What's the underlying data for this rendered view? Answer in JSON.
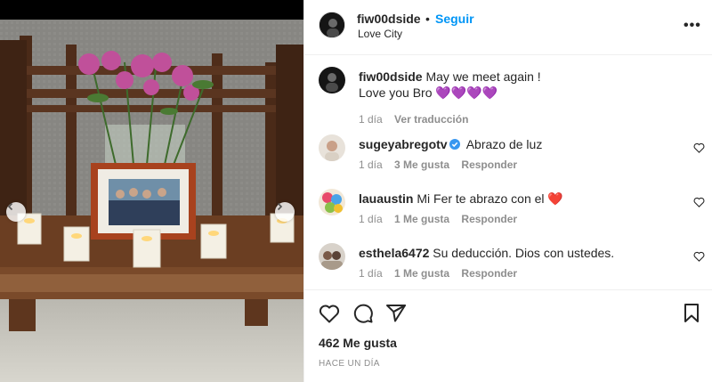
{
  "header": {
    "username": "fiw00dside",
    "separator": "•",
    "follow_label": "Seguir",
    "location": "Love City",
    "more_label": "•••"
  },
  "caption": {
    "username": "fiw00dside",
    "line1": "May we meet again !",
    "line2": "Love you Bro 💜💜💜💜",
    "time": "1 día",
    "translate_label": "Ver traducción"
  },
  "comments": [
    {
      "username": "sugeyabregotv",
      "verified": true,
      "text": "Abrazo de luz",
      "time": "1 día",
      "likes": "3 Me gusta",
      "reply": "Responder"
    },
    {
      "username": "lauaustin",
      "verified": false,
      "text": "Mi Fer te abrazo con el ❤️",
      "time": "1 día",
      "likes": "1 Me gusta",
      "reply": "Responder"
    },
    {
      "username": "esthela6472",
      "verified": false,
      "text": "Su deducción. Dios con ustedes.",
      "time": "1 día",
      "likes": "1 Me gusta",
      "reply": "Responder"
    }
  ],
  "footer": {
    "likes": "462 Me gusta",
    "date": "HACE UN DÍA"
  },
  "icons": {
    "like": "heart-icon",
    "comment": "comment-icon",
    "share": "share-icon",
    "save": "bookmark-icon",
    "carousel_prev": "chevron-left-icon",
    "carousel_next": "chevron-right-icon"
  },
  "colors": {
    "accent": "#0095f6",
    "text": "#262626",
    "muted": "#8e8e8e",
    "border": "#efefef",
    "verified": "#3897f0"
  }
}
